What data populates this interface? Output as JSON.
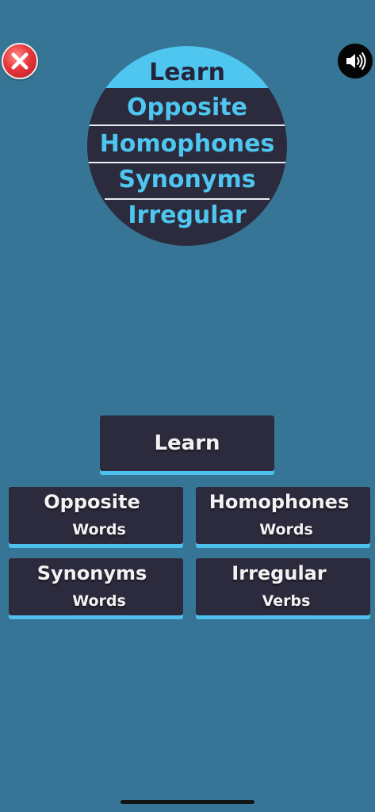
{
  "header": {
    "close_icon": "close-icon",
    "sound_icon": "speaker-volume-icon"
  },
  "logo": {
    "items": [
      "Learn",
      "Opposite",
      "Homophones",
      "Synonyms",
      "Irregular"
    ]
  },
  "main": {
    "learn_label": "Learn",
    "cards": [
      {
        "title": "Opposite",
        "subtitle": "Words"
      },
      {
        "title": "Homophones",
        "subtitle": "Words"
      },
      {
        "title": "Synonyms",
        "subtitle": "Words"
      },
      {
        "title": "Irregular",
        "subtitle": "Verbs"
      }
    ]
  },
  "colors": {
    "background": "#367595",
    "panel": "#2c2b3d",
    "accent": "#4ec6f0",
    "close_red": "#e8383d"
  }
}
